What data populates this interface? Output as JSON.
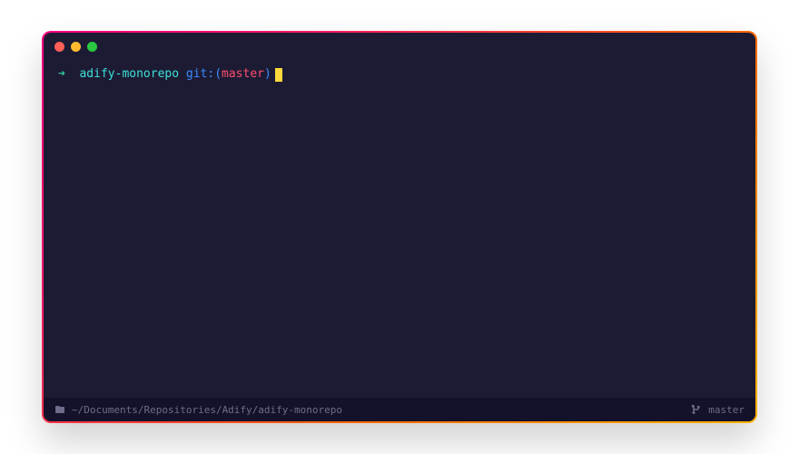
{
  "prompt": {
    "arrow": "➜",
    "directory": "adify-monorepo",
    "git_label": "git:",
    "paren_open": "(",
    "branch": "master",
    "paren_close": ")"
  },
  "statusbar": {
    "path": "~/Documents/Repositories/Adify/adify-monorepo",
    "branch": "master"
  },
  "colors": {
    "bg": "#1d1b34",
    "status_bg": "#14122a",
    "arrow": "#2fc997",
    "directory": "#3de0d6",
    "git": "#3b8cff",
    "branch": "#ff4d6d",
    "cursor": "#ffd93b",
    "status_text": "#6f6b8a",
    "border_gradient_start": "#ff0080",
    "border_gradient_end": "#ffb300"
  }
}
